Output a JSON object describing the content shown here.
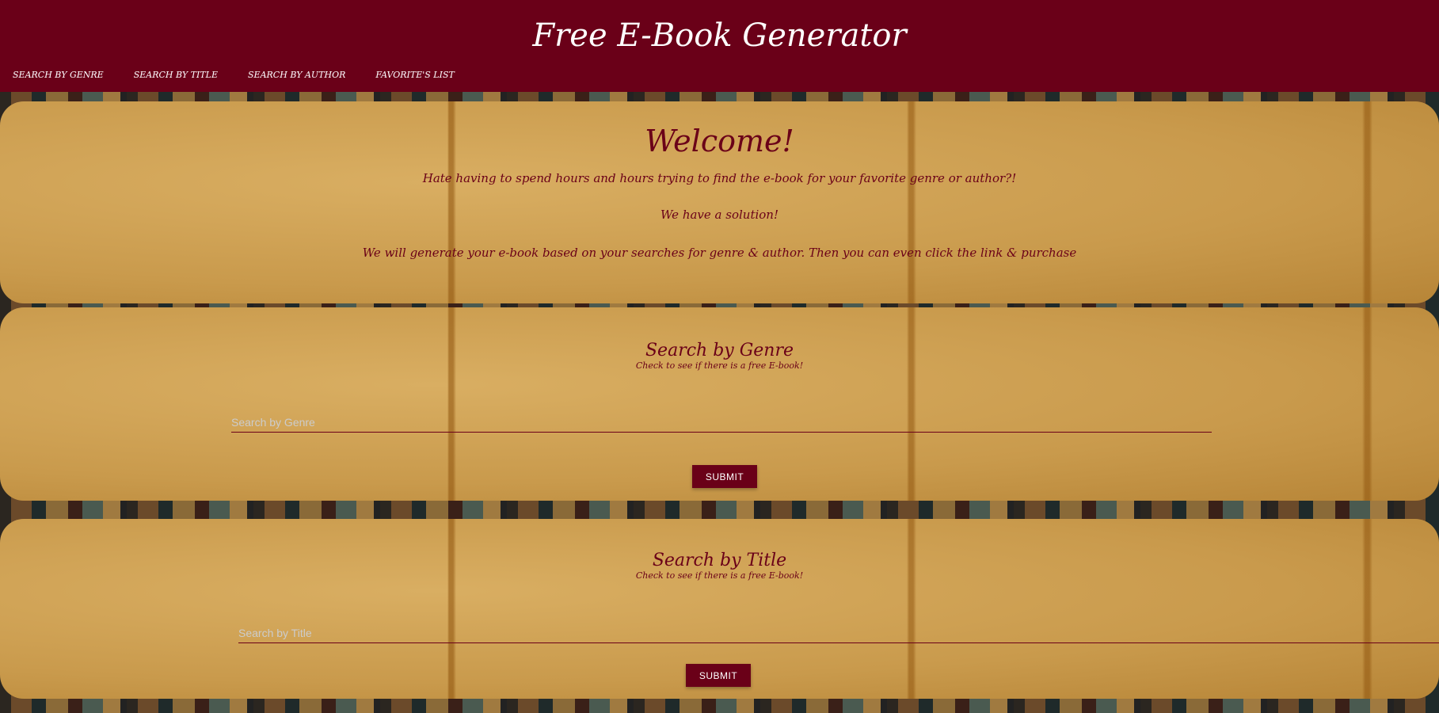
{
  "header": {
    "title": "Free E-Book Generator",
    "nav": [
      "Search by Genre",
      "Search by Title",
      "Search by Author",
      "Favorite's List"
    ]
  },
  "welcome": {
    "heading": "Welcome!",
    "lines": [
      "Hate having to spend hours and hours trying to find the e-book for your favorite genre or author?!",
      "We have a solution!",
      "We will generate your e-book based on your searches for genre & author. Then you can even click the link & purchase"
    ]
  },
  "genre": {
    "heading": "Search by Genre",
    "subheading": "Check to see if there is a free E-book!",
    "placeholder": "Search by Genre",
    "submit": "SUBMIT"
  },
  "title_search": {
    "heading": "Search by Title",
    "subheading": "Check to see if there is a free E-book!",
    "placeholder": "Search by Title",
    "submit": "SUBMIT"
  },
  "colors": {
    "brand": "#6a0018"
  }
}
